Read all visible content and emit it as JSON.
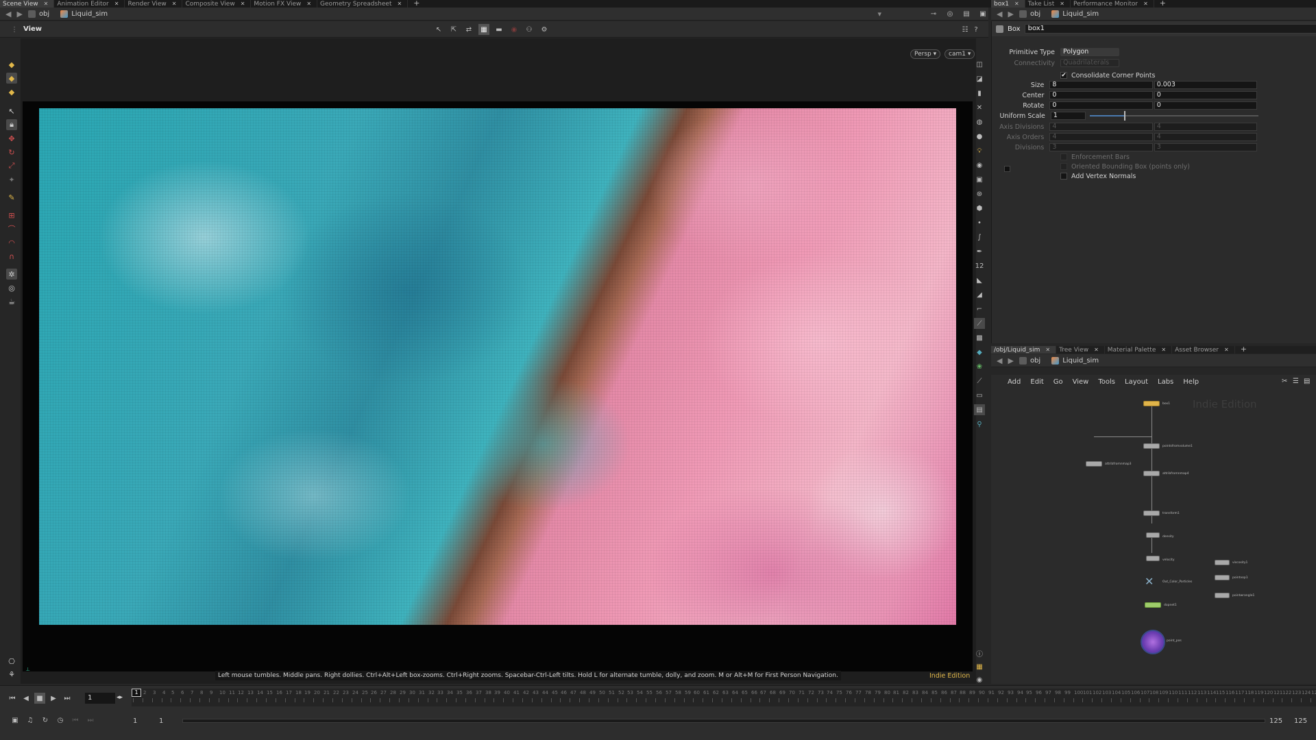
{
  "left_tabs": [
    {
      "label": "Scene View",
      "active": true
    },
    {
      "label": "Animation Editor",
      "active": false
    },
    {
      "label": "Render View",
      "active": false
    },
    {
      "label": "Composite View",
      "active": false
    },
    {
      "label": "Motion FX View",
      "active": false
    },
    {
      "label": "Geometry Spreadsheet",
      "active": false
    }
  ],
  "right_tabs_top": [
    {
      "label": "box1",
      "active": true
    },
    {
      "label": "Take List",
      "active": false
    },
    {
      "label": "Performance Monitor",
      "active": false
    }
  ],
  "path": {
    "root": "obj",
    "node": "Liquid_sim"
  },
  "viewport": {
    "title": "View",
    "persp": "Persp ▾",
    "cam": "cam1 ▾",
    "nav_hint": "Left mouse tumbles. Middle pans. Right dollies. Ctrl+Alt+Left box-zooms. Ctrl+Right zooms. Spacebar-Ctrl-Left tilts. Hold L for alternate tumble, dolly, and zoom.    M or Alt+M for First Person Navigation.",
    "edition": "Indie Edition"
  },
  "params": {
    "node_type": "Box",
    "node_name": "box1",
    "rows": [
      {
        "label": "Primitive Type",
        "kind": "menu",
        "value": "Polygon",
        "dim": false
      },
      {
        "label": "Connectivity",
        "kind": "menu",
        "value": "Quadrilaterals",
        "dim": true
      },
      {
        "label": "",
        "kind": "check",
        "value": "Consolidate Corner Points",
        "checked": true,
        "dim": false
      },
      {
        "label": "Size",
        "kind": "vec",
        "values": [
          "8",
          "0.003"
        ],
        "dim": false
      },
      {
        "label": "Center",
        "kind": "vec",
        "values": [
          "0",
          "0"
        ],
        "dim": false
      },
      {
        "label": "Rotate",
        "kind": "vec",
        "values": [
          "0",
          "0"
        ],
        "dim": false
      },
      {
        "label": "Uniform Scale",
        "kind": "slider",
        "value": "1",
        "dim": false
      },
      {
        "label": "Axis Divisions",
        "kind": "vec",
        "values": [
          "4",
          "4"
        ],
        "dim": true
      },
      {
        "label": "Axis Orders",
        "kind": "vec",
        "values": [
          "4",
          "4"
        ],
        "dim": true
      },
      {
        "label": "Divisions",
        "kind": "vec",
        "values": [
          "3",
          "3"
        ],
        "dim": true
      },
      {
        "label": "",
        "kind": "check",
        "value": "Enforcement Bars",
        "checked": false,
        "dim": true
      },
      {
        "label": "",
        "kind": "check",
        "value": "Oriented Bounding Box (points only)",
        "checked": false,
        "dim": true
      },
      {
        "label": "",
        "kind": "check",
        "value": "Add Vertex Normals",
        "checked": false,
        "dim": false
      }
    ]
  },
  "bottom_tabs": [
    {
      "label": "/obj/Liquid_sim",
      "active": true
    },
    {
      "label": "Tree View",
      "active": false
    },
    {
      "label": "Material Palette",
      "active": false
    },
    {
      "label": "Asset Browser",
      "active": false
    }
  ],
  "network": {
    "menu": [
      "Add",
      "Edit",
      "Go",
      "View",
      "Tools",
      "Layout",
      "Labs",
      "Help"
    ],
    "watermark": "Indie Edition",
    "nodes": [
      {
        "id": "box1",
        "label": "box1"
      },
      {
        "id": "pfv",
        "label": "pointsfromvolume1"
      },
      {
        "id": "attr3",
        "label": "attribfromnmap3"
      },
      {
        "id": "attr4",
        "label": "attribfromnmap4"
      },
      {
        "id": "xf",
        "label": "transform1"
      },
      {
        "id": "dens",
        "label": "density"
      },
      {
        "id": "vel",
        "label": "velocity"
      },
      {
        "id": "out",
        "label": "Out_Color_Particles"
      },
      {
        "id": "dop",
        "label": "dopnet1"
      },
      {
        "id": "pv",
        "label": "point_pos"
      },
      {
        "id": "v1",
        "label": "viscosity1"
      },
      {
        "id": "pop",
        "label": "pointvop1"
      },
      {
        "id": "wr",
        "label": "pointwrangle1"
      }
    ]
  },
  "timeline": {
    "frame": "1",
    "start": "1",
    "start2": "1",
    "end": "125",
    "end2": "125",
    "ticks": [
      "1",
      "2",
      "3",
      "4",
      "5",
      "6",
      "7",
      "8",
      "9",
      "10",
      "11",
      "12",
      "13",
      "14",
      "15",
      "16",
      "17",
      "18",
      "19",
      "20",
      "21",
      "22",
      "23",
      "24",
      "25",
      "26",
      "27",
      "28",
      "29",
      "30",
      "31",
      "32",
      "33",
      "34",
      "35",
      "36",
      "37",
      "38",
      "39",
      "40",
      "41",
      "42",
      "43",
      "44",
      "45",
      "46",
      "47",
      "48",
      "49",
      "50",
      "51",
      "52",
      "53",
      "54",
      "55",
      "56",
      "57",
      "58",
      "59",
      "60",
      "61",
      "62",
      "63",
      "64",
      "65",
      "66",
      "67",
      "68",
      "69",
      "70",
      "71",
      "72",
      "73",
      "74",
      "75",
      "76",
      "77",
      "78",
      "79",
      "80",
      "81",
      "82",
      "83",
      "84",
      "85",
      "86",
      "87",
      "88",
      "89",
      "90",
      "91",
      "92",
      "93",
      "94",
      "95",
      "96",
      "97",
      "98",
      "99",
      "100",
      "101",
      "102",
      "103",
      "104",
      "105",
      "106",
      "107",
      "108",
      "109",
      "110",
      "111",
      "112",
      "113",
      "114",
      "115",
      "116",
      "117",
      "118",
      "119",
      "120",
      "121",
      "122",
      "123",
      "124",
      "125"
    ]
  },
  "colors": {
    "accent": "#e2b84a",
    "network_bg": "#2b2b2b",
    "viewport_bg": "#1e1e1e"
  }
}
